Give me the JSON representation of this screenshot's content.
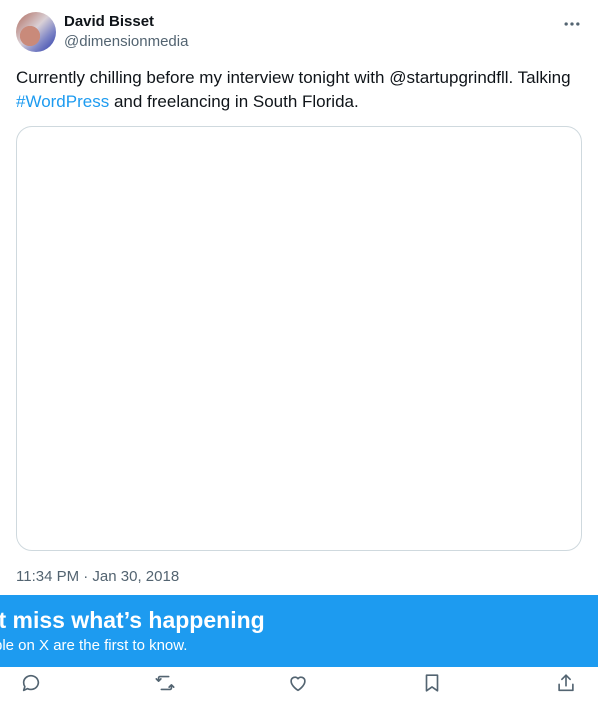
{
  "author": {
    "display_name": "David Bisset",
    "handle": "@dimensionmedia",
    "avatar_icon": "avatar-photo"
  },
  "tweet": {
    "text_part1": "Currently chilling before my interview tonight with @startupgrindfll. Talking ",
    "hashtag": "#WordPress",
    "text_part2": " and freelancing in South Florida.",
    "timestamp": "11:34 PM · Jan 30, 2018"
  },
  "banner": {
    "title": "n’t miss what’s happening",
    "subtitle": "ple on X are the first to know."
  },
  "actions": [
    "reply-icon",
    "retweet-icon",
    "like-icon",
    "bookmark-icon",
    "share-icon"
  ],
  "colors": {
    "accent": "#1d9bf0",
    "text": "#0f1419",
    "muted": "#536471",
    "border": "#cfd9de"
  }
}
